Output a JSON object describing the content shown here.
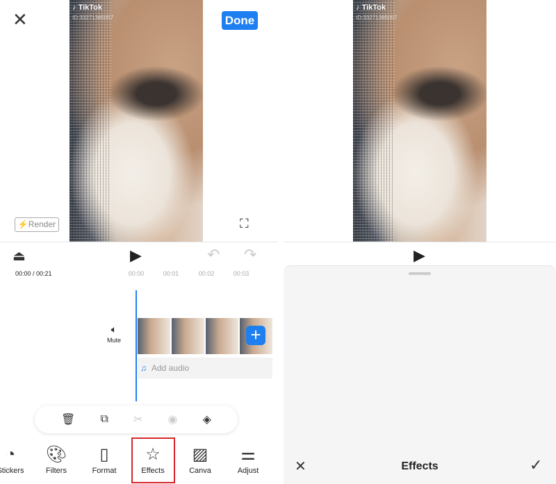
{
  "left": {
    "close_icon": "close-icon",
    "done_label": "Done",
    "watermark": {
      "brand": "TikTok",
      "id": "ID:33271385057"
    },
    "render_label": "Render",
    "time_display": "00:00 / 00:21",
    "ticks": [
      "00:00",
      "00:01",
      "00:02",
      "00:03"
    ],
    "mute_label": "Mute",
    "add_audio_label": "Add audio",
    "actions": [
      "delete-icon",
      "duplicate-icon",
      "split-icon",
      "hide-icon",
      "replace-icon"
    ],
    "tools": [
      {
        "label": "Stickers",
        "icon": "sticker-icon"
      },
      {
        "label": "Filters",
        "icon": "palette-icon"
      },
      {
        "label": "Format",
        "icon": "format-icon"
      },
      {
        "label": "Effects",
        "icon": "effects-icon"
      },
      {
        "label": "Canva",
        "icon": "canvas-icon"
      },
      {
        "label": "Adjust",
        "icon": "sliders-icon"
      }
    ],
    "highlight_color": "#d7262b",
    "accent": "#1e7ff0"
  },
  "right": {
    "watermark": {
      "brand": "TikTok",
      "id": "ID:33271385057"
    },
    "sheet_title": "Effects"
  }
}
